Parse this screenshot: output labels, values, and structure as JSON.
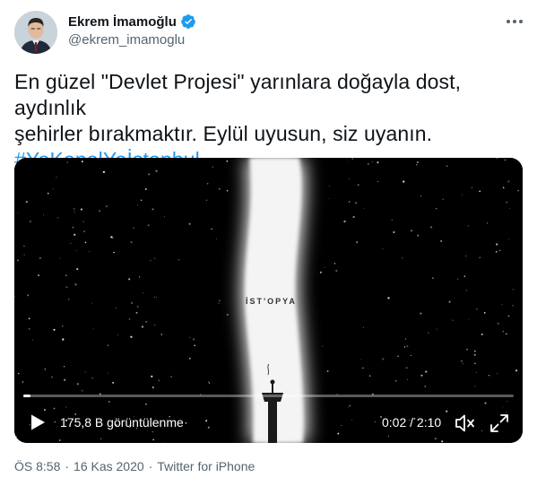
{
  "author": {
    "display_name": "Ekrem İmamoğlu",
    "handle": "@ekrem_imamoglu",
    "verified_icon": "verified-badge-icon"
  },
  "tweet": {
    "text_line1": "En güzel \"Devlet Projesi\" yarınlara doğayla dost, aydınlık",
    "text_line2": "şehirler bırakmaktır. Eylül uyusun, siz uyanın.",
    "hashtag": "#YaKanalYaİstanbul"
  },
  "video": {
    "overlay_title": "İST'OPYA",
    "views_label": "175,8 B görüntülenme",
    "time_label": "0:02 / 2:10",
    "progress": 0.015
  },
  "footer": {
    "time": "ÖS 8:58",
    "date": "16 Kas 2020",
    "source": "Twitter for iPhone"
  },
  "colors": {
    "accent": "#1d9bf0",
    "secondary_text": "#536471"
  }
}
